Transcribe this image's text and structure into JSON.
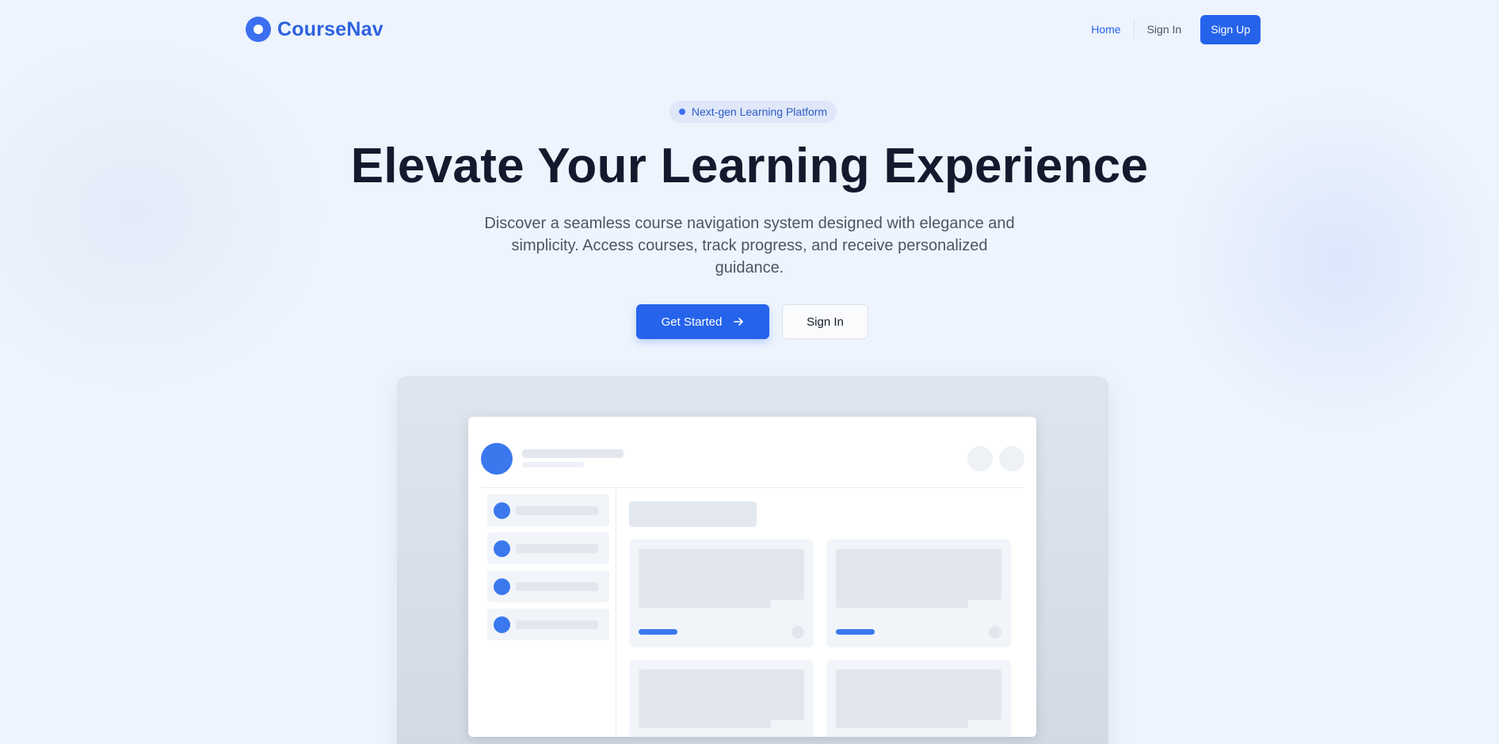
{
  "brand": {
    "name": "CourseNav",
    "logo_icon": "circle-logo-icon",
    "color": "#2563eb"
  },
  "nav": {
    "home_label": "Home",
    "signin_label": "Sign In",
    "signup_label": "Sign Up"
  },
  "hero": {
    "badge": "Next-gen Learning Platform",
    "title": "Elevate Your Learning Experience",
    "subtitle": "Discover a seamless course navigation system designed with elegance and simplicity. Access courses, track progress, and receive personalized guidance.",
    "primary_cta": "Get Started",
    "primary_cta_icon": "arrow-right-icon",
    "secondary_cta": "Sign In"
  },
  "preview": {
    "sidebar_item_count": 4,
    "course_card_count": 4,
    "accent": "#3b78ee"
  }
}
